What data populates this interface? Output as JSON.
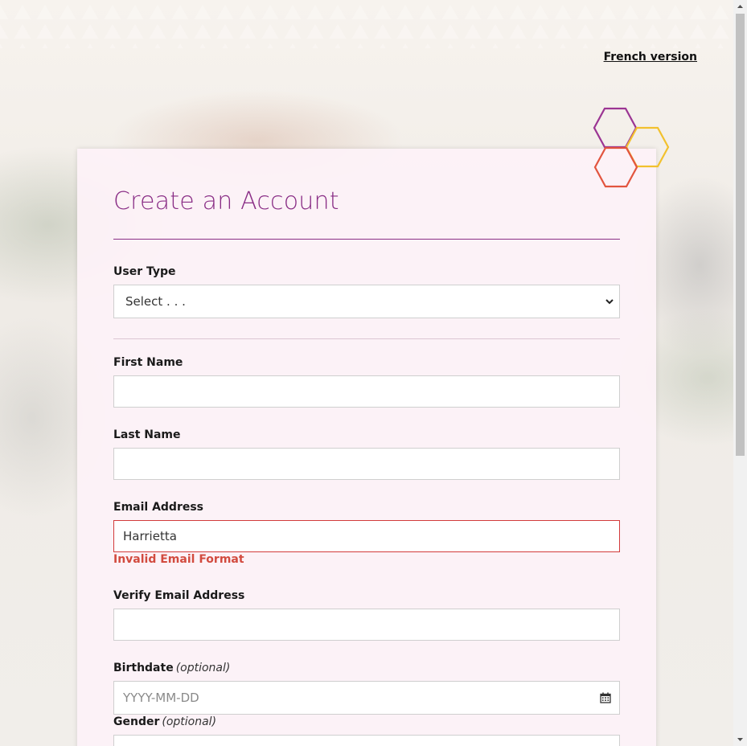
{
  "header": {
    "french_link": "French version"
  },
  "form": {
    "title": "Create an Account",
    "user_type": {
      "label": "User Type",
      "value": "Select . . ."
    },
    "first_name": {
      "label": "First Name",
      "value": ""
    },
    "last_name": {
      "label": "Last Name",
      "value": ""
    },
    "email": {
      "label": "Email Address",
      "value": "Harrietta",
      "error": "Invalid Email Format"
    },
    "verify_email": {
      "label": "Verify Email Address",
      "value": ""
    },
    "birthdate": {
      "label": "Birthdate",
      "optional": "(optional)",
      "placeholder": "YYYY-MM-DD"
    },
    "gender": {
      "label": "Gender",
      "optional": "(optional)"
    }
  },
  "colors": {
    "title": "#8a2e86",
    "error": "#d24b3f",
    "hex_purple": "#9b3593",
    "hex_yellow": "#f2c12e",
    "hex_red": "#e2553f"
  },
  "icons": [
    "hexagon-logo-icon",
    "chevron-down-icon",
    "calendar-icon",
    "scroll-up-arrow-icon",
    "scroll-down-arrow-icon"
  ]
}
